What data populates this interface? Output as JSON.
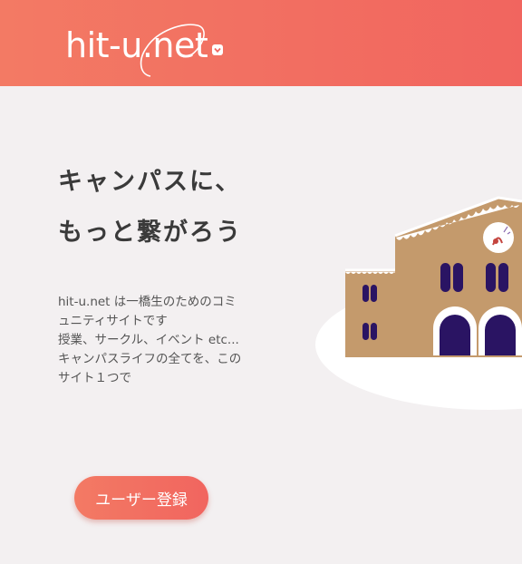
{
  "header": {
    "logo_text": "hit-u.net",
    "logo_icon": "map-pin-icon",
    "background_color": "#f1655f"
  },
  "hero": {
    "heading_line1": "キャンパスに、",
    "heading_line2": "もっと繋がろう",
    "description_line1": "hit-u.net は一橋生のためのコミ",
    "description_line2": "ュニティサイトです",
    "description_line3": "授業、サークル、イベント etc...",
    "description_line4": "キャンパスライフの全てを、この",
    "description_line5": "サイト１つで"
  },
  "actions": {
    "register_label": "ユーザー登録"
  },
  "illustration": {
    "name": "campus-building-illustration",
    "wall_color": "#c49a6c",
    "window_color": "#2a1463"
  }
}
